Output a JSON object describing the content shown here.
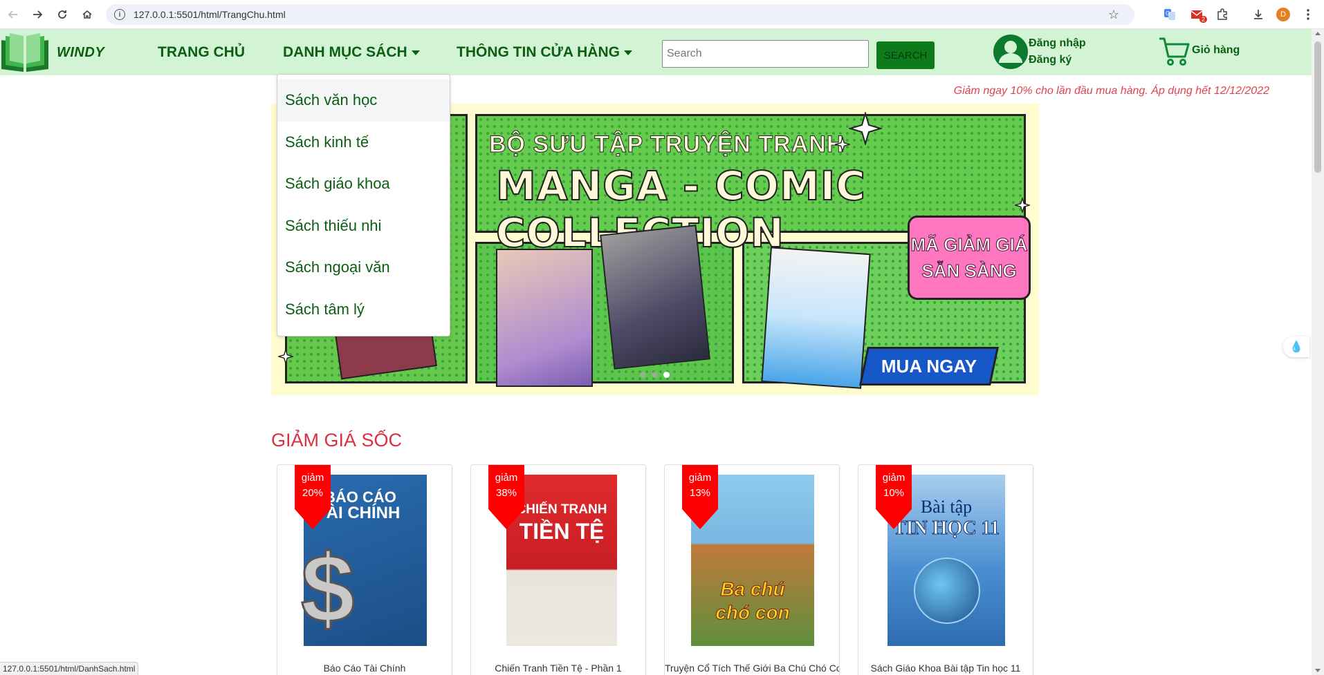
{
  "browser": {
    "url": "127.0.0.1:5501/html/TrangChu.html",
    "status_url": "127.0.0.1:5501/html/DanhSach.html",
    "profile_letter": "D",
    "mail_badge": "2"
  },
  "header": {
    "logo_text": "WINDY",
    "menu": {
      "home": "TRANG CHỦ",
      "categories": "DANH MỤC SÁCH",
      "store_info": "THÔNG TIN CỬA HÀNG"
    },
    "search_placeholder": "Search",
    "search_button": "SEARCH",
    "login": "Đăng nhập",
    "register": "Đăng ký",
    "cart": "Giỏ hàng"
  },
  "dropdown": {
    "items": [
      "Sách văn học",
      "Sách kinh tế",
      "Sách giáo khoa",
      "Sách thiếu nhi",
      "Sách ngoại văn",
      "Sách tâm lý"
    ]
  },
  "promo_text": "Giảm ngay 10% cho lần đầu mua hàng. Áp dụng hết 12/12/2022",
  "banner": {
    "title1": "BỘ SƯU TẬP TRUYỆN TRANH",
    "title2": "MANGA - COMIC COLLECTION",
    "bubble_line1": "MÃ GIẢM GIÁ",
    "bubble_line2": "SẴN SÀNG",
    "cta": "MUA NGAY",
    "active_slide": 3
  },
  "sale_section": {
    "title": "GIẢM GIÁ SỐC",
    "products": [
      {
        "discount_label": "giảm",
        "discount": "20%",
        "title": "Báo Cáo Tài Chính",
        "cover_text1": "BÁO CÁO",
        "cover_text2": "TÀI CHÍNH",
        "cover_color": "#1e5aa0"
      },
      {
        "discount_label": "giảm",
        "discount": "38%",
        "title": "Chiến Tranh Tiền Tệ - Phần 1",
        "cover_text1": "CHIẾN TRANH",
        "cover_text2": "TIỀN TỆ",
        "cover_color": "#d8232a"
      },
      {
        "discount_label": "giảm",
        "discount": "13%",
        "title": "Truyện Cổ Tích Thế Giới Ba Chú Chó Con",
        "cover_text1": "Ba chú",
        "cover_text2": "chó con",
        "cover_color": "#6aa8d8"
      },
      {
        "discount_label": "giảm",
        "discount": "10%",
        "title": "Sách Giáo Khoa Bài tập Tin học 11",
        "cover_text1": "Bài tập",
        "cover_text2": "TIN HỌC 11",
        "cover_color": "#3f86cf"
      }
    ]
  },
  "colors": {
    "header_bg": "#d3f3d5",
    "brand_green": "#0b5e12",
    "accent_red": "#dc3040",
    "ribbon_red": "#ff0000"
  }
}
